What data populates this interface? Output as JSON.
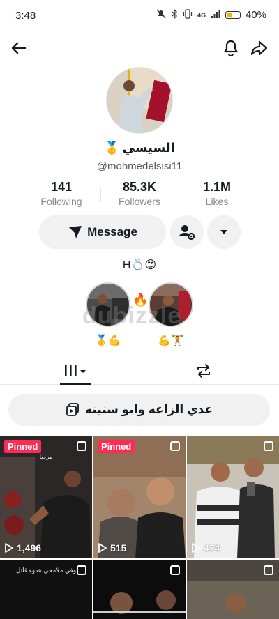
{
  "status_bar": {
    "time": "3:48",
    "network": "4G",
    "battery_percent": "40%",
    "battery_level": 0.4,
    "icons": [
      "mute-icon",
      "bluetooth-icon",
      "vibrate-icon",
      "signal-icon",
      "battery-icon"
    ]
  },
  "header": {
    "icons": [
      "back-arrow-icon",
      "bell-icon",
      "share-icon"
    ]
  },
  "profile": {
    "display_name": "السيسي",
    "name_emoji": "🥇",
    "username": "@mohmedelsisi11",
    "stats": [
      {
        "value": "141",
        "label": "Following"
      },
      {
        "value": "85.3K",
        "label": "Followers"
      },
      {
        "value": "1.1M",
        "label": "Likes"
      }
    ],
    "message_label": "Message",
    "bio": "H💍😍"
  },
  "highlights": [
    {
      "caption": "🥇💪"
    },
    {
      "caption": "💪🏋"
    }
  ],
  "highlight_fire": "🔥",
  "watermark": "dubizzle",
  "tabs": [
    "videos-grid-icon",
    "repost-icon"
  ],
  "playlist": {
    "label": "عدي الزاغه وابو سنينه"
  },
  "videos": [
    {
      "pinned_label": "Pinned",
      "views": "1,496",
      "top_text": "مرحبا"
    },
    {
      "pinned_label": "Pinned",
      "views": "515",
      "top_text": ""
    },
    {
      "pinned_label": "",
      "views": "474",
      "top_text": ""
    },
    {
      "pinned_label": "",
      "views": "",
      "top_text": "وفي ملامحي هدوء قاتل"
    },
    {
      "pinned_label": "",
      "views": "",
      "top_text": ""
    },
    {
      "pinned_label": "",
      "views": "",
      "top_text": ""
    }
  ],
  "colors": {
    "accent": "#fe2c55",
    "button_bg": "#f1f1f2",
    "text": "#161823",
    "secondary_text": "#888888"
  }
}
